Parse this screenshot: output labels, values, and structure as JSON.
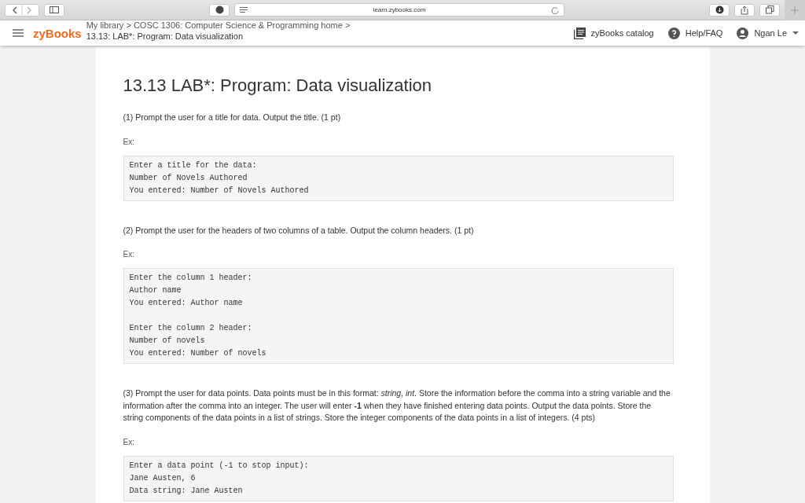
{
  "browser": {
    "url": "learn.zybooks.com"
  },
  "header": {
    "logo": "zyBooks",
    "breadcrumb": "My library > COSC 1306: Computer Science & Programming home >",
    "current": "13.13: LAB*: Program: Data visualization",
    "links": [
      {
        "kind": "catalog",
        "label": "zyBooks catalog"
      },
      {
        "kind": "help",
        "label": "Help/FAQ"
      },
      {
        "kind": "user",
        "label": "Ngan Le"
      }
    ]
  },
  "content": {
    "title": "13.13 LAB*: Program: Data visualization",
    "sections": [
      {
        "prompt": "(1) Prompt the user for a title for data. Output the title. (1 pt)",
        "example_label": "Ex:",
        "example": [
          [
            "Enter a title for the data:",
            "Number of Novels Authored",
            "You entered: Number of Novels Authored"
          ]
        ]
      },
      {
        "prompt": "(2) Prompt the user for the headers of two columns of a table. Output the column headers. (1 pt)",
        "example_label": "Ex:",
        "example": [
          [
            "Enter the column 1 header:",
            "Author name",
            "You entered: Author name"
          ],
          [
            "Enter the column 2 header:",
            "Number of novels",
            "You entered: Number of novels"
          ]
        ]
      },
      {
        "prompt": "(3) Prompt the user for data points. Data points must be in this format: *string, int*. Store the information before the comma into a string variable and the information after the comma into an integer. The user will enter **-1** when they have finished entering data points. Output the data points. Store the string components of the data points in a list of strings. Store the integer components of the data points in a list of integers. (4 pts)",
        "example_label": "Ex:",
        "example": [
          [
            "Enter a data point (-1 to stop input):",
            "Jane Austen, 6",
            "Data string: Jane Austen"
          ]
        ]
      }
    ]
  }
}
